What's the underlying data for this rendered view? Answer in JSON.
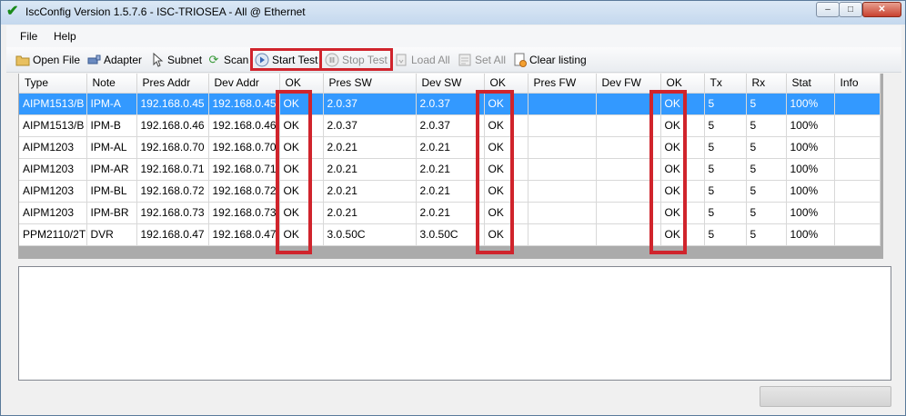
{
  "window": {
    "title": "IscConfig Version 1.5.7.6 - ISC-TRIOSEA - All @ Ethernet",
    "controls": {
      "minimize": "–",
      "maximize": "□",
      "close": "✕"
    }
  },
  "menu": {
    "file": "File",
    "help": "Help"
  },
  "toolbar": {
    "open_file": "Open File",
    "adapter": "Adapter",
    "subnet": "Subnet",
    "scan": "Scan",
    "start_test": "Start Test",
    "stop_test": "Stop Test",
    "load_all": "Load All",
    "set_all": "Set All",
    "clear_listing": "Clear listing"
  },
  "icons": {
    "app": "check-icon",
    "open_file": "folder-icon",
    "adapter": "network-adapter-icon",
    "subnet": "cursor-icon",
    "scan": "refresh-icon",
    "start_test": "play-icon",
    "stop_test": "pause-icon",
    "load_all": "load-icon",
    "set_all": "set-icon",
    "clear_listing": "clear-document-icon"
  },
  "colors": {
    "selection": "#3399ff",
    "highlight": "#d0242c",
    "accent_green": "#1a8a1a"
  },
  "grid": {
    "columns": [
      "Type",
      "Note",
      "Pres Addr",
      "Dev Addr",
      "OK",
      "Pres SW",
      "Dev SW",
      "OK",
      "Pres FW",
      "Dev FW",
      "OK",
      "Tx",
      "Rx",
      "Stat",
      "Info"
    ],
    "rows": [
      [
        "AIPM1513/B",
        "IPM-A",
        "192.168.0.45",
        "192.168.0.45",
        "OK",
        "2.0.37",
        "2.0.37",
        "OK",
        "",
        "",
        "OK",
        "5",
        "5",
        "100%",
        ""
      ],
      [
        "AIPM1513/B",
        "IPM-B",
        "192.168.0.46",
        "192.168.0.46",
        "OK",
        "2.0.37",
        "2.0.37",
        "OK",
        "",
        "",
        "OK",
        "5",
        "5",
        "100%",
        ""
      ],
      [
        "AIPM1203",
        "IPM-AL",
        "192.168.0.70",
        "192.168.0.70",
        "OK",
        "2.0.21",
        "2.0.21",
        "OK",
        "",
        "",
        "OK",
        "5",
        "5",
        "100%",
        ""
      ],
      [
        "AIPM1203",
        "IPM-AR",
        "192.168.0.71",
        "192.168.0.71",
        "OK",
        "2.0.21",
        "2.0.21",
        "OK",
        "",
        "",
        "OK",
        "5",
        "5",
        "100%",
        ""
      ],
      [
        "AIPM1203",
        "IPM-BL",
        "192.168.0.72",
        "192.168.0.72",
        "OK",
        "2.0.21",
        "2.0.21",
        "OK",
        "",
        "",
        "OK",
        "5",
        "5",
        "100%",
        ""
      ],
      [
        "AIPM1203",
        "IPM-BR",
        "192.168.0.73",
        "192.168.0.73",
        "OK",
        "2.0.21",
        "2.0.21",
        "OK",
        "",
        "",
        "OK",
        "5",
        "5",
        "100%",
        ""
      ],
      [
        "PPM2110/2T",
        "DVR",
        "192.168.0.47",
        "192.168.0.47",
        "OK",
        "3.0.50C",
        "3.0.50C",
        "OK",
        "",
        "",
        "OK",
        "5",
        "5",
        "100%",
        ""
      ]
    ],
    "selected_row": 0
  },
  "log": {
    "text": ""
  }
}
